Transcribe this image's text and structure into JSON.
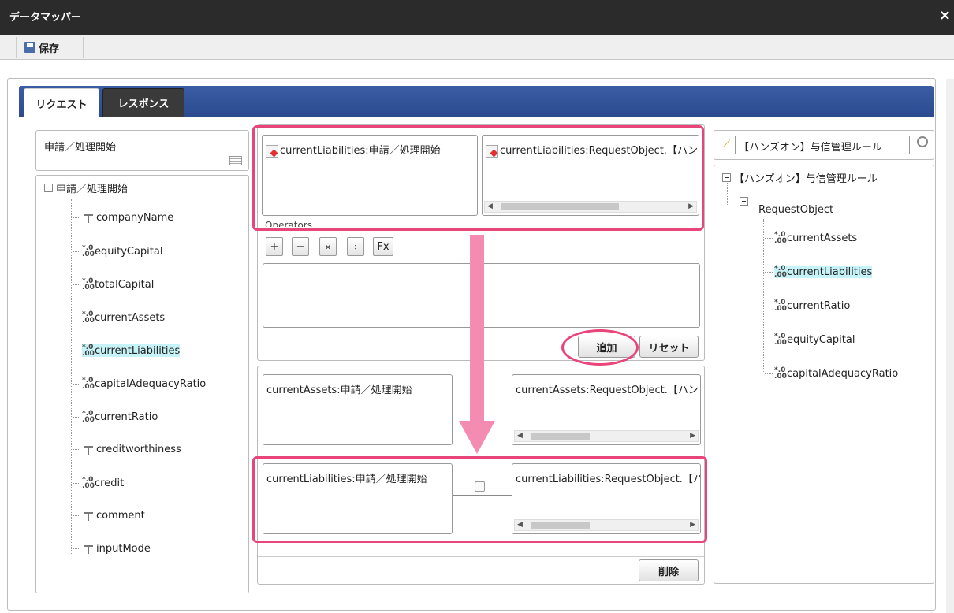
{
  "window": {
    "title": "データマッパー",
    "close_label": "×"
  },
  "toolbar": {
    "save_label": "保存"
  },
  "tabs": [
    {
      "label": "リクエスト"
    },
    {
      "label": "レスポンス"
    }
  ],
  "left": {
    "field_value": "申請／処理開始",
    "root_label": "申請／処理開始",
    "items": [
      {
        "label": "companyName",
        "type": "text"
      },
      {
        "label": "equityCapital",
        "type": "number"
      },
      {
        "label": "totalCapital",
        "type": "number"
      },
      {
        "label": "currentAssets",
        "type": "number"
      },
      {
        "label": "currentLiabilities",
        "type": "number",
        "selected": true
      },
      {
        "label": "capitalAdequacyRatio",
        "type": "number"
      },
      {
        "label": "currentRatio",
        "type": "number"
      },
      {
        "label": "creditworthiness",
        "type": "text"
      },
      {
        "label": "credit",
        "type": "number"
      },
      {
        "label": "comment",
        "type": "text"
      },
      {
        "label": "inputMode",
        "type": "text"
      }
    ]
  },
  "center": {
    "source_box": "currentLiabilities:申請／処理開始",
    "target_box": "currentLiabilities:RequestObject.【ハン",
    "operators_label": "Operators",
    "operators": [
      "+",
      "−",
      "×",
      "÷",
      "Fx"
    ],
    "add_button": "追加",
    "reset_button": "リセット",
    "mappings": [
      {
        "source": "currentAssets:申請／処理開始",
        "target": "currentAssets:RequestObject.【ハン"
      },
      {
        "source": "currentLiabilities:申請／処理開始",
        "target": "currentLiabilities:RequestObject.【ハ"
      }
    ],
    "delete_button": "削除"
  },
  "right": {
    "search_value": "【ハンズオン】与信管理ルール",
    "root_label": "【ハンズオン】与信管理ルール",
    "object_label": "RequestObject",
    "items": [
      {
        "label": "currentAssets",
        "type": "number"
      },
      {
        "label": "currentLiabilities",
        "type": "number",
        "selected": true
      },
      {
        "label": "currentRatio",
        "type": "number"
      },
      {
        "label": "equityCapital",
        "type": "number"
      },
      {
        "label": "capitalAdequacyRatio",
        "type": "number"
      }
    ]
  },
  "colors": {
    "highlight": "#e8457a",
    "tab_bar": "#2b4a8e",
    "selected": "#c6f3f7",
    "arrow": "#f38cb0"
  }
}
